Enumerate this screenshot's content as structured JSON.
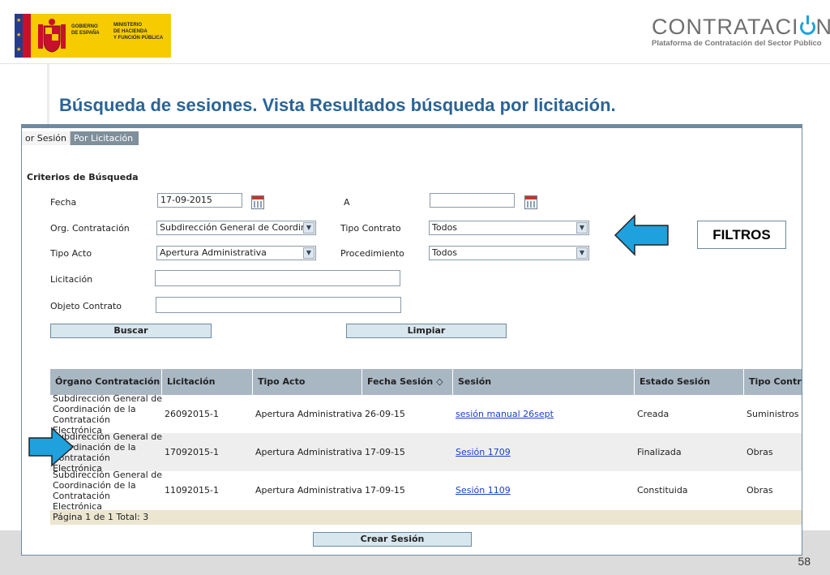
{
  "header": {
    "gov_logo": {
      "line1": "GOBIERNO\nDE ESPAÑA",
      "line2": "MINISTERIO\nDE HACIENDA\nY FUNCIÓN PÚBLICA"
    },
    "brand": {
      "name_left": "CONTRATACI",
      "name_right": "N",
      "subtitle": "Plataforma de Contratación del Sector Público"
    },
    "colors": {
      "title": "#2a6496",
      "brand_accent": "#1ea1dc",
      "arrow": "#1ea1dc"
    }
  },
  "slide": {
    "title": "Búsqueda de sesiones. Vista Resultados búsqueda por licitación.",
    "page_number": "58"
  },
  "tabs": [
    {
      "label": "or Sesión",
      "selected": false
    },
    {
      "label": "Por Licitación",
      "selected": true
    }
  ],
  "criteria": {
    "title": "Criterios de Búsqueda",
    "fecha": {
      "label": "Fecha",
      "value": "17-09-2015"
    },
    "a": {
      "label": "A",
      "value": ""
    },
    "org": {
      "label": "Org. Contratación",
      "value": "Subdirección General de Coordin"
    },
    "tipo_contrato": {
      "label": "Tipo Contrato",
      "value": "Todos"
    },
    "tipo_acto": {
      "label": "Tipo Acto",
      "value": "Apertura Administrativa"
    },
    "procedimiento": {
      "label": "Procedimiento",
      "value": "Todos"
    },
    "licitacion": {
      "label": "Licitación",
      "value": ""
    },
    "objeto": {
      "label": "Objeto Contrato",
      "value": ""
    },
    "buscar": "Buscar",
    "limpiar": "Limpiar"
  },
  "grid": {
    "columns": [
      "Órgano Contratación",
      "Licitación",
      "Tipo Acto",
      "Fecha Sesión",
      "Sesión",
      "Estado Sesión",
      "Tipo Contrat"
    ],
    "sort_icon": "sort-updown-icon",
    "rows": [
      {
        "organo": "Subdirección General de\nCoordinación de la\nContratación Electrónica",
        "licitacion": "26092015-1",
        "tipo_acto": "Apertura Administrativa",
        "fecha": "26-09-15",
        "sesion": "sesión manual 26sept",
        "estado": "Creada",
        "tipo_contrato": "Suministros"
      },
      {
        "organo": "Subdirección General de\nCoordinación de la\nContratación Electrónica",
        "licitacion": "17092015-1",
        "tipo_acto": "Apertura Administrativa",
        "fecha": "17-09-15",
        "sesion": "Sesión 1709",
        "estado": "Finalizada",
        "tipo_contrato": "Obras"
      },
      {
        "organo": "Subdirección General de\nCoordinación de la\nContratación Electrónica",
        "licitacion": "11092015-1",
        "tipo_acto": "Apertura Administrativa",
        "fecha": "17-09-15",
        "sesion": "Sesión 1109",
        "estado": "Constituida",
        "tipo_contrato": "Obras"
      }
    ],
    "pager": "Página 1 de 1 Total: 3"
  },
  "crear_sesion": "Crear Sesión",
  "callout": {
    "label": "FILTROS"
  }
}
